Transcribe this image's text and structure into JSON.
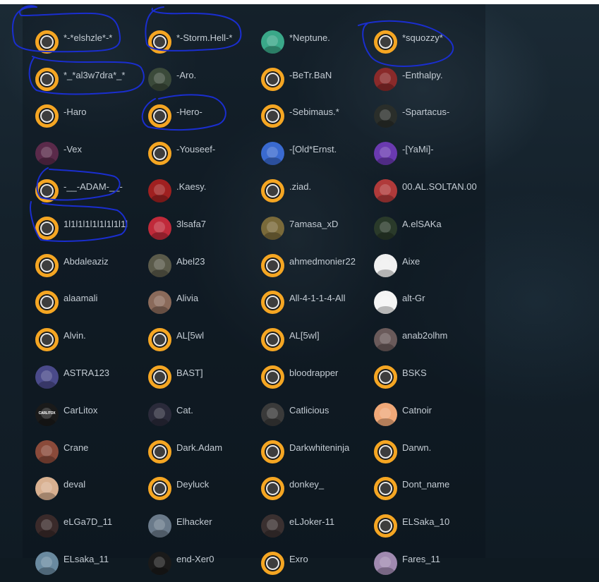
{
  "members": [
    {
      "name": "*-*elshzle*-*",
      "avatar": "default",
      "circled": true
    },
    {
      "name": "*-Storm.Hell-*",
      "avatar": "default",
      "circled": true
    },
    {
      "name": "*Neptune.",
      "avatar": "photo",
      "color": "#3aa889"
    },
    {
      "name": "*squozzy*",
      "avatar": "default",
      "circled": true
    },
    {
      "name": "*_*al3w7dra*_*",
      "avatar": "default",
      "circled": true
    },
    {
      "name": "-Aro.",
      "avatar": "photo",
      "color": "#3b4a3a"
    },
    {
      "name": "-BeTr.BaN",
      "avatar": "default"
    },
    {
      "name": "-Enthalpy.",
      "avatar": "photo",
      "color": "#8a2a2a"
    },
    {
      "name": "-Haro",
      "avatar": "default"
    },
    {
      "name": "-Hero-",
      "avatar": "default",
      "circled": true
    },
    {
      "name": "-Sebimaus.*",
      "avatar": "default"
    },
    {
      "name": "-Spartacus-",
      "avatar": "photo",
      "color": "#2a2e2a"
    },
    {
      "name": "-Vex",
      "avatar": "photo",
      "color": "#5a2a4a"
    },
    {
      "name": "-Youseef-",
      "avatar": "default"
    },
    {
      "name": "-[Old*Ernst.",
      "avatar": "photo",
      "color": "#3a6ad0"
    },
    {
      "name": "-[YaMi]-",
      "avatar": "photo",
      "color": "#6a3ab0"
    },
    {
      "name": "-__-ADAM-__-",
      "avatar": "default",
      "circled": true
    },
    {
      "name": ".Kaesy.",
      "avatar": "photo",
      "color": "#a02020"
    },
    {
      "name": ".ziad.",
      "avatar": "default"
    },
    {
      "name": "00.AL.SOLTAN.00",
      "avatar": "photo",
      "color": "#b03a3a"
    },
    {
      "name": "1l1l1l1l1l1l1l1l1l",
      "avatar": "default",
      "circled": true
    },
    {
      "name": "3lsafa7",
      "avatar": "photo",
      "color": "#c02a3a"
    },
    {
      "name": "7amasa_xD",
      "avatar": "photo",
      "color": "#7a6a3a"
    },
    {
      "name": "A.elSAKa",
      "avatar": "photo",
      "color": "#2a3a2a"
    },
    {
      "name": "Abdaleaziz",
      "avatar": "default"
    },
    {
      "name": "Abel23",
      "avatar": "photo",
      "color": "#5a5a4a"
    },
    {
      "name": "ahmedmonier22",
      "avatar": "default"
    },
    {
      "name": "Aixe",
      "avatar": "photo",
      "color": "#f0f0f0"
    },
    {
      "name": "alaamali",
      "avatar": "default"
    },
    {
      "name": "Alivia",
      "avatar": "photo",
      "color": "#8a6a5a"
    },
    {
      "name": "All-4-1-1-4-All",
      "avatar": "default"
    },
    {
      "name": "alt-Gr",
      "avatar": "photo",
      "color": "#f4f4f4"
    },
    {
      "name": "Alvin.",
      "avatar": "default"
    },
    {
      "name": "AL[5wl",
      "avatar": "default"
    },
    {
      "name": "AL[5wl]",
      "avatar": "default"
    },
    {
      "name": "anab2olhm",
      "avatar": "photo",
      "color": "#6a5a5a"
    },
    {
      "name": "ASTRA123",
      "avatar": "photo",
      "color": "#4a4a8a"
    },
    {
      "name": "BAST]",
      "avatar": "default"
    },
    {
      "name": "bloodrapper",
      "avatar": "default"
    },
    {
      "name": "BSKS",
      "avatar": "default"
    },
    {
      "name": "CarLitox",
      "avatar": "photo",
      "color": "#1a1a1a",
      "label": "CARLITOX"
    },
    {
      "name": "Cat.",
      "avatar": "photo",
      "color": "#2a2a3a"
    },
    {
      "name": "Catlicious",
      "avatar": "photo",
      "color": "#3a3a3a"
    },
    {
      "name": "Catnoir",
      "avatar": "photo",
      "color": "#f0a878"
    },
    {
      "name": "Crane",
      "avatar": "photo",
      "color": "#8a4a3a"
    },
    {
      "name": "Dark.Adam",
      "avatar": "default"
    },
    {
      "name": "Darkwhiteninja",
      "avatar": "default"
    },
    {
      "name": "Darwn.",
      "avatar": "default"
    },
    {
      "name": "deval",
      "avatar": "photo",
      "color": "#d8b090"
    },
    {
      "name": "Deyluck",
      "avatar": "default"
    },
    {
      "name": "donkey_",
      "avatar": "default"
    },
    {
      "name": "Dont_name",
      "avatar": "default"
    },
    {
      "name": "eLGa7D_11",
      "avatar": "photo",
      "color": "#3a2a2a"
    },
    {
      "name": "Elhacker",
      "avatar": "photo",
      "color": "#6a7a8a"
    },
    {
      "name": "eLJoker-11",
      "avatar": "photo",
      "color": "#3a3030"
    },
    {
      "name": "ELSaka_10",
      "avatar": "default"
    },
    {
      "name": "ELsaka_11",
      "avatar": "photo",
      "color": "#6a8aa0"
    },
    {
      "name": "end-Xer0",
      "avatar": "photo",
      "color": "#1a1a1a"
    },
    {
      "name": "Exro",
      "avatar": "default"
    },
    {
      "name": "Fares_11",
      "avatar": "photo",
      "color": "#a08ab0"
    }
  ]
}
